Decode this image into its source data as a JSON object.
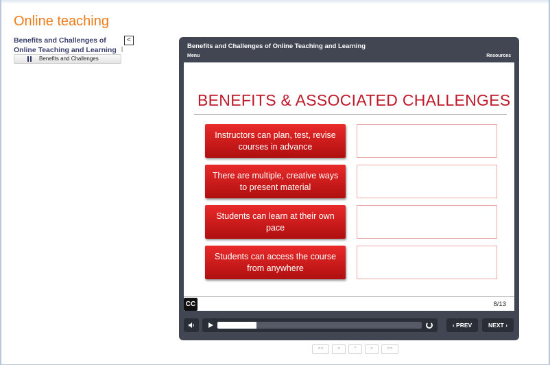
{
  "course": {
    "title": "Online teaching"
  },
  "toc": {
    "heading": "Benefits and Challenges of Online Teaching and Learning",
    "collapse_label": "<",
    "items": [
      {
        "label": "Benefits and Challenges"
      }
    ]
  },
  "player": {
    "title": "Benefits and Challenges of Online Teaching and Learning",
    "menu_label": "Menu",
    "resources_label": "Resources",
    "cc_label": "CC",
    "slide_counter": "8/13",
    "seek_progress_fraction": 0.19,
    "prev_label": "PREV",
    "next_label": "NEXT",
    "prev_icon": "‹",
    "next_icon": "›"
  },
  "slide": {
    "heading": "BENEFITS & ASSOCIATED CHALLENGES",
    "benefits": [
      {
        "text": "Instructors can plan, test, revise courses in advance"
      },
      {
        "text": "There are multiple, creative ways to present material"
      },
      {
        "text": "Students can learn at their own pace"
      },
      {
        "text": "Students can access the course from anywhere"
      }
    ]
  },
  "bottom_nav": {
    "first": "<<",
    "prev": "<",
    "up": "^",
    "next": ">",
    "last": ">>"
  },
  "colors": {
    "course_title": "#f07b1a",
    "slide_heading": "#c0192a",
    "benefit_button": "#d81e1e",
    "player_chrome": "#414652"
  }
}
